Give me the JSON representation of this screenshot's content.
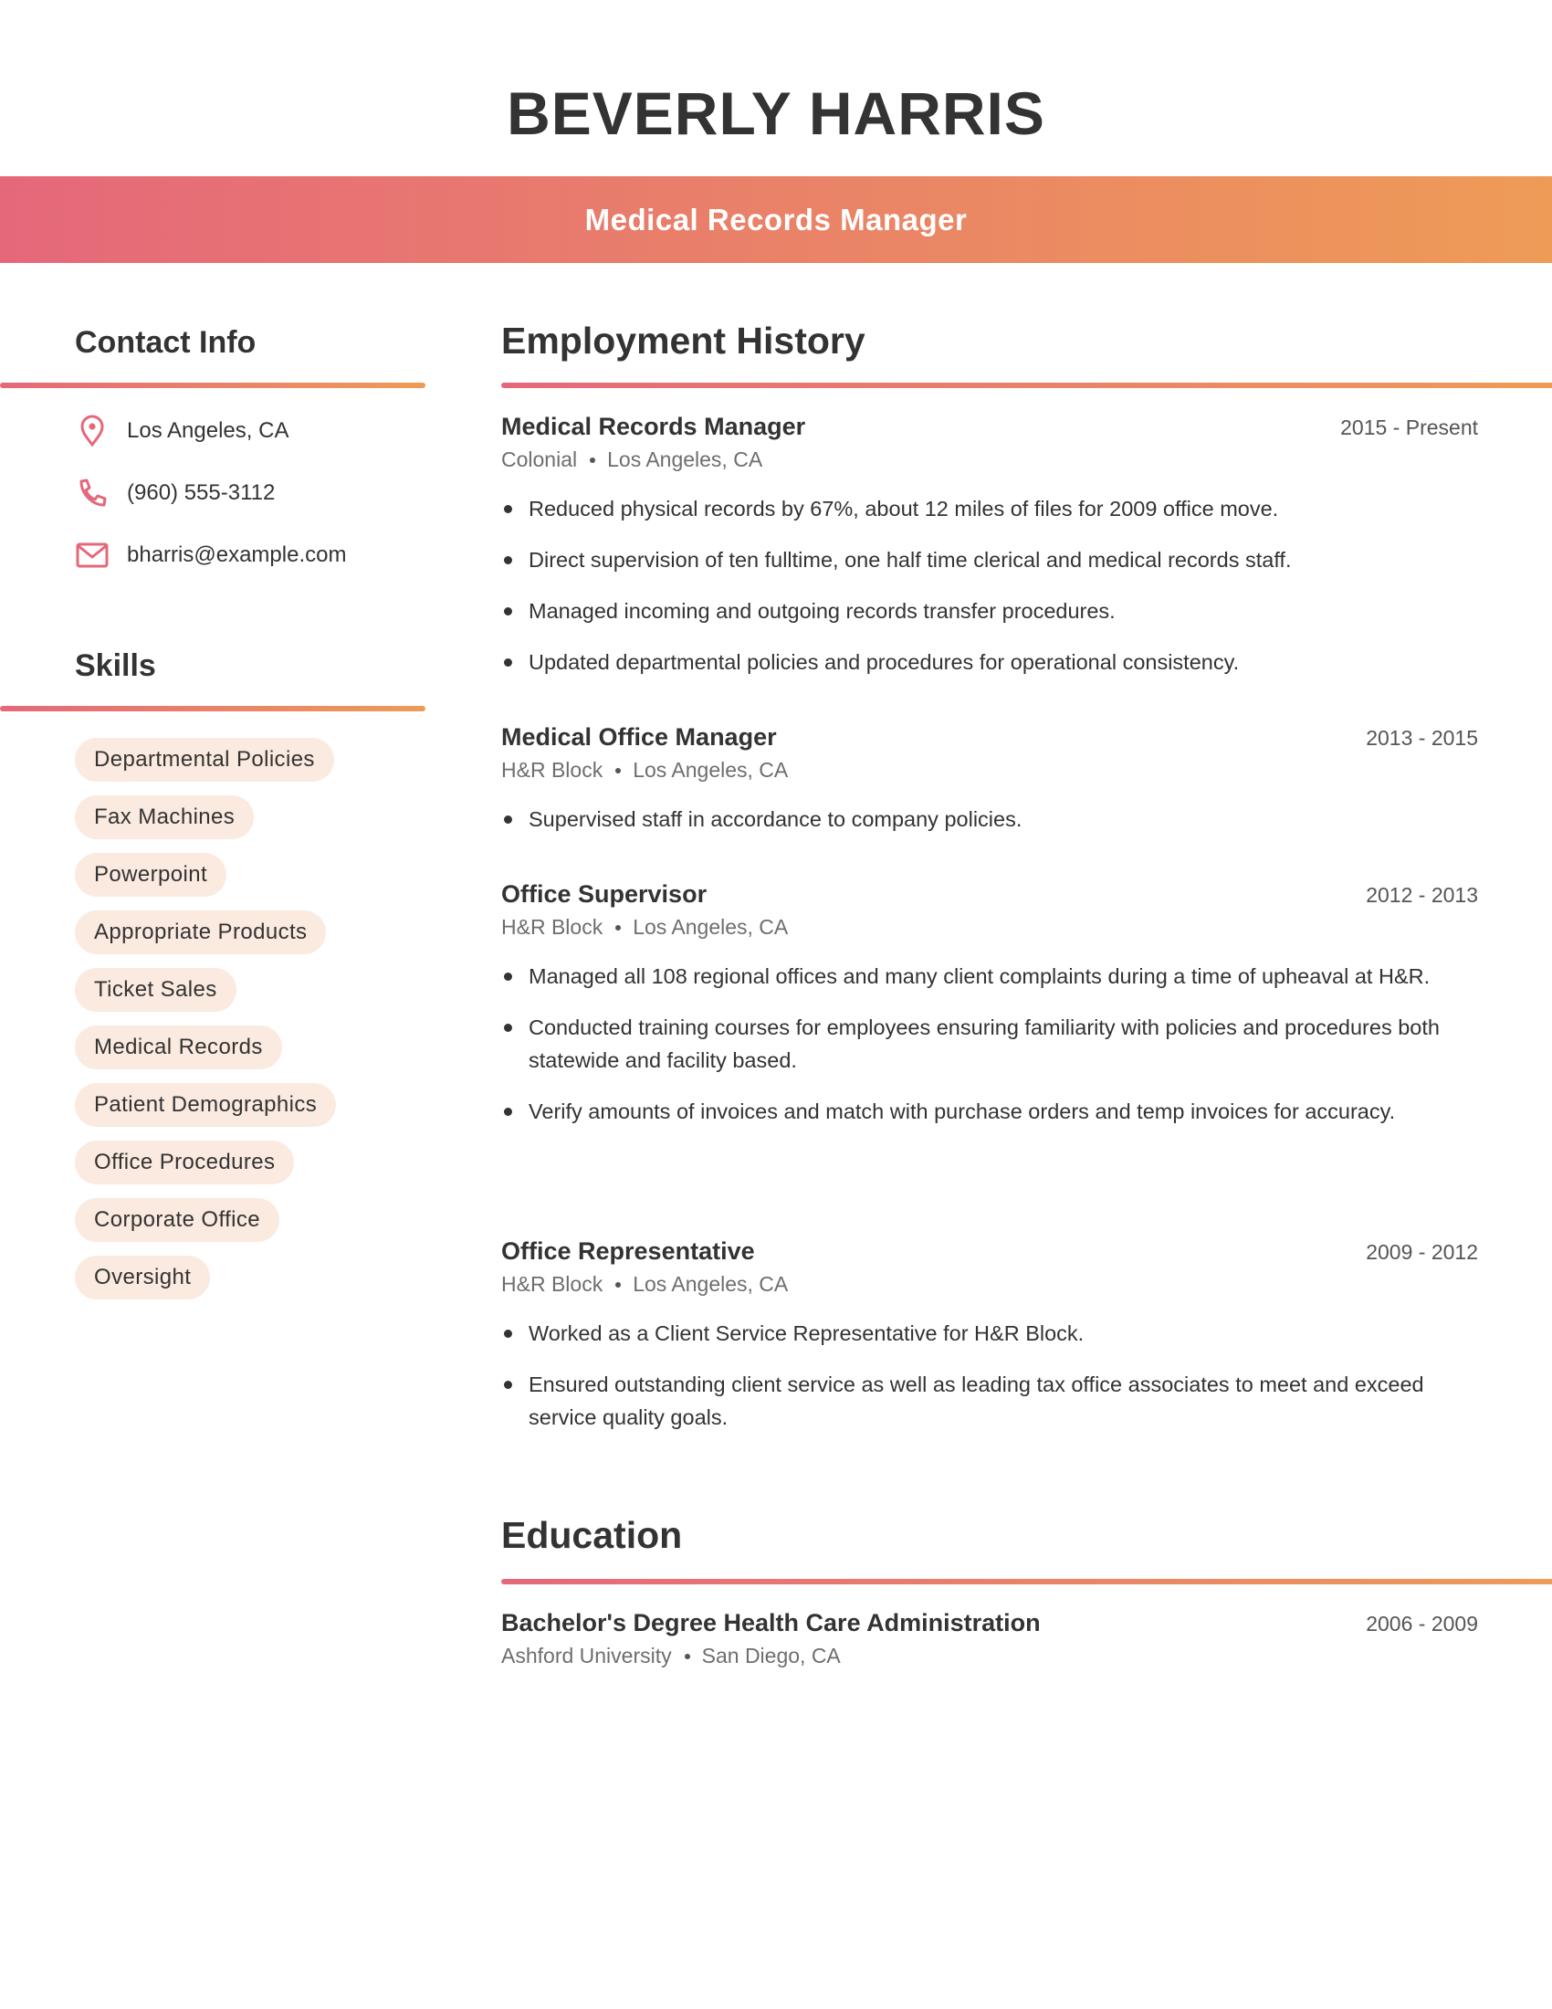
{
  "header": {
    "name": "BEVERLY HARRIS",
    "title": "Medical Records Manager"
  },
  "colors": {
    "gradient_start": "#E5687A",
    "gradient_end": "#EE9B57",
    "chip_bg": "#FBEADF",
    "icon": "#E5687A",
    "text": "#333333"
  },
  "sidebar": {
    "contact": {
      "heading": "Contact Info",
      "items": [
        {
          "icon": "map-pin-icon",
          "text": "Los Angeles, CA"
        },
        {
          "icon": "phone-icon",
          "text": "(960) 555-3112"
        },
        {
          "icon": "email-icon",
          "text": "bharris@example.com"
        }
      ]
    },
    "skills": {
      "heading": "Skills",
      "items": [
        "Departmental Policies",
        "Fax Machines",
        "Powerpoint",
        "Appropriate Products",
        "Ticket Sales",
        "Medical Records",
        "Patient Demographics",
        "Office Procedures",
        "Corporate Office",
        "Oversight"
      ]
    }
  },
  "employment": {
    "heading": "Employment History",
    "jobs": [
      {
        "title": "Medical Records Manager",
        "dates": "2015 - Present",
        "company": "Colonial",
        "location": "Los Angeles, CA",
        "bullets": [
          "Reduced physical records by 67%, about 12 miles of files for 2009 office move.",
          "Direct supervision of ten fulltime, one half time clerical and medical records staff.",
          "Managed incoming and outgoing records transfer procedures.",
          "Updated departmental policies and procedures for operational consistency."
        ]
      },
      {
        "title": "Medical Office Manager",
        "dates": "2013 - 2015",
        "company": "H&R Block",
        "location": "Los Angeles, CA",
        "bullets": [
          "Supervised staff in accordance to company policies."
        ]
      },
      {
        "title": "Office Supervisor",
        "dates": "2012 - 2013",
        "company": "H&R Block",
        "location": "Los Angeles, CA",
        "bullets": [
          "Managed all 108 regional offices and many client complaints during a time of upheaval at H&R.",
          "Conducted training courses for employees ensuring familiarity with policies and procedures both statewide and facility based.",
          "Verify amounts of invoices and match with purchase orders and temp invoices for accuracy."
        ]
      },
      {
        "title": "Office Representative",
        "dates": "2009 - 2012",
        "company": "H&R Block",
        "location": "Los Angeles, CA",
        "bullets": [
          "Worked as a Client Service Representative for H&R Block.",
          "Ensured outstanding client service as well as leading tax office associates to meet and exceed service quality goals."
        ]
      }
    ]
  },
  "education": {
    "heading": "Education",
    "items": [
      {
        "degree": "Bachelor's Degree Health Care Administration",
        "dates": "2006 - 2009",
        "school": "Ashford University",
        "location": "San Diego, CA"
      }
    ]
  }
}
